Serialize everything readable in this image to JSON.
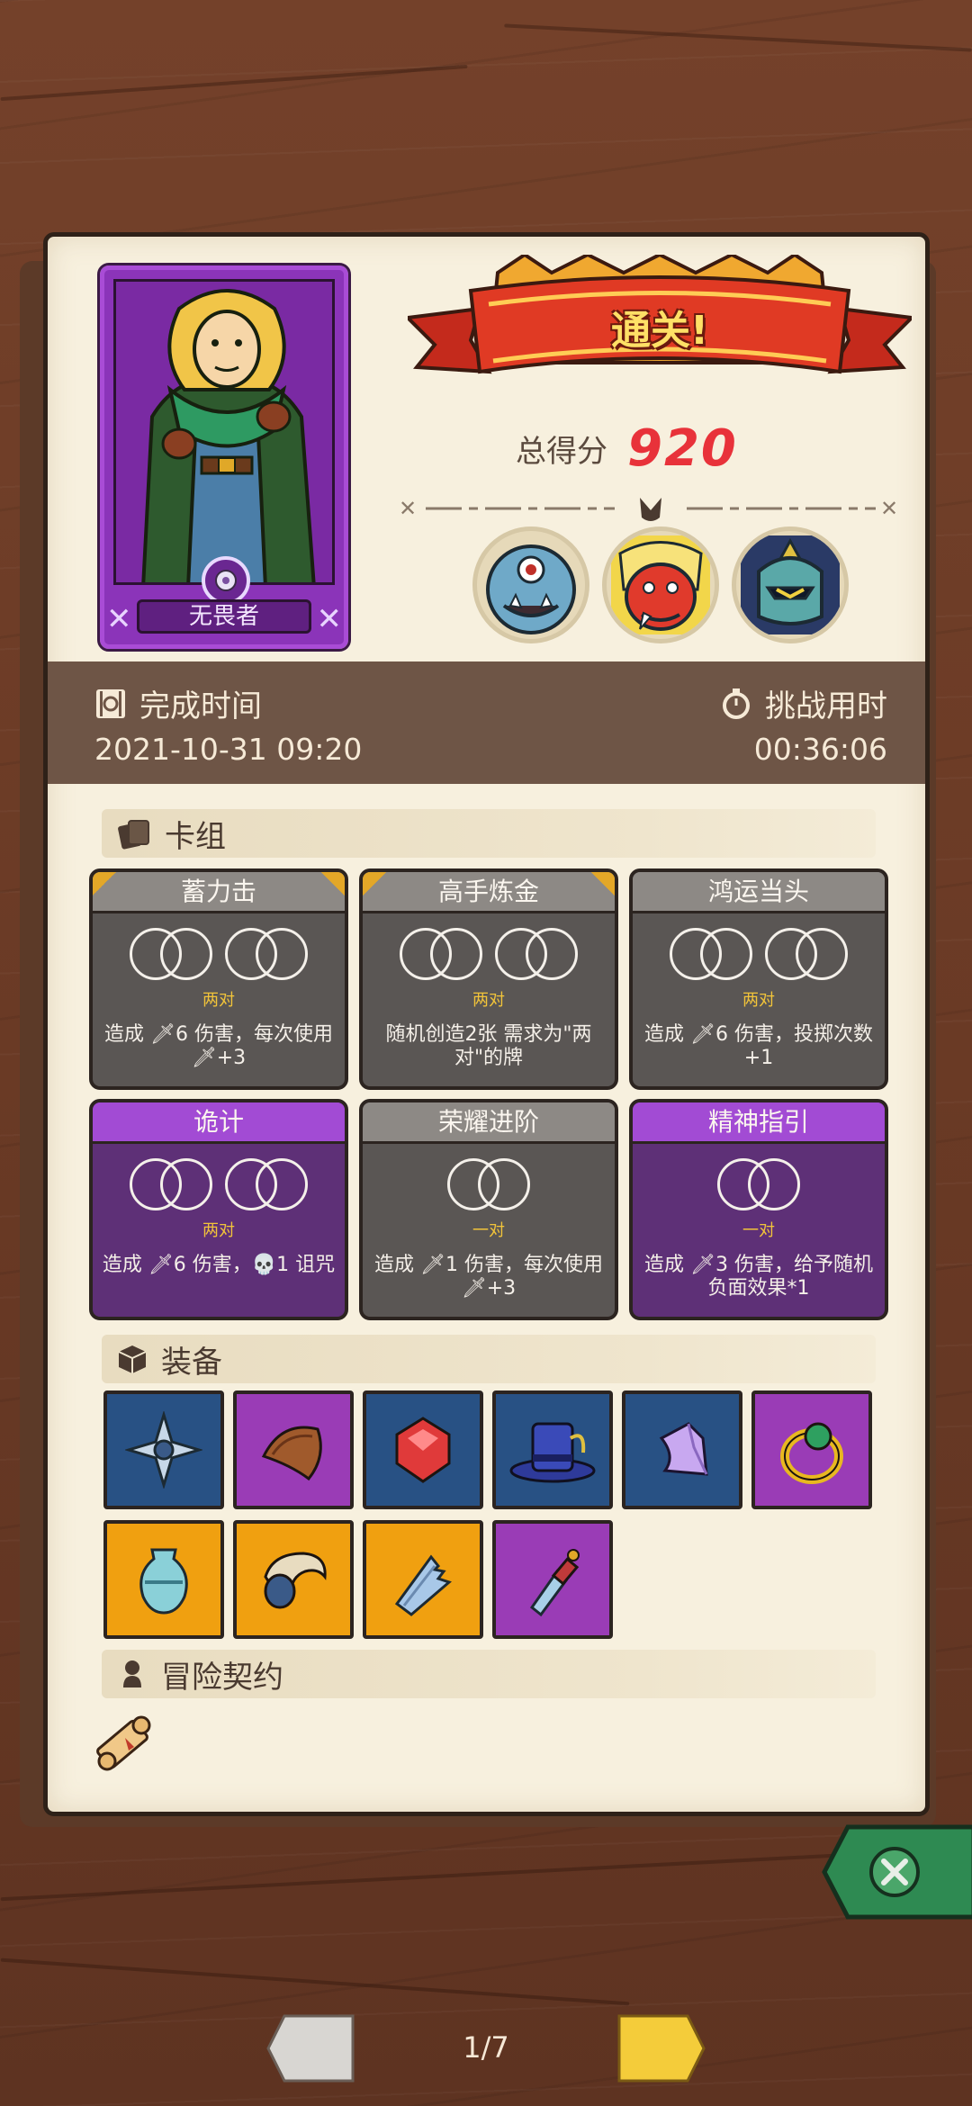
{
  "hero": {
    "name": "无畏者",
    "card_color": "#8b34b9"
  },
  "result": {
    "banner_text": "通关!",
    "score_label": "总得分",
    "score_value": "920"
  },
  "bosses": [
    {
      "icon": "blue-ogre-boss-icon"
    },
    {
      "icon": "red-demon-boss-icon"
    },
    {
      "icon": "armored-knight-boss-icon"
    }
  ],
  "time": {
    "finish_label": "完成时间",
    "finish_value": "2021-10-31 09:20",
    "challenge_label": "挑战用时",
    "challenge_value": "00:36:06"
  },
  "deck": {
    "title": "卡组",
    "cards": [
      {
        "name": "蓄力击",
        "tag": "两对",
        "desc": "造成 🗡6 伤害，每次使用 🗡+3",
        "style": "gray",
        "gold": true
      },
      {
        "name": "高手炼金",
        "tag": "两对",
        "desc": "随机创造2张 需求为\"两对\"的牌",
        "style": "gray",
        "gold": true
      },
      {
        "name": "鸿运当头",
        "tag": "两对",
        "desc": "造成 🗡6 伤害，投掷次数 +1",
        "style": "gray",
        "gold": false
      },
      {
        "name": "诡计",
        "tag": "两对",
        "desc": "造成 🗡6 伤害，💀1 诅咒",
        "style": "purple",
        "gold": false
      },
      {
        "name": "荣耀进阶",
        "tag": "一对",
        "desc": "造成 🗡1 伤害，每次使用 🗡+3",
        "style": "gray",
        "gold": false
      },
      {
        "name": "精神指引",
        "tag": "一对",
        "desc": "造成 🗡3 伤害，给予随机负面效果*1",
        "style": "purple",
        "gold": false
      }
    ]
  },
  "equipment": {
    "title": "装备",
    "items": [
      {
        "icon": "silver-star-emblem-icon",
        "color": "blue"
      },
      {
        "icon": "leather-shoulder-pad-icon",
        "color": "purple"
      },
      {
        "icon": "red-gem-icon",
        "color": "blue"
      },
      {
        "icon": "blue-top-hat-icon",
        "color": "blue"
      },
      {
        "icon": "purple-crescent-icon",
        "color": "blue"
      },
      {
        "icon": "emerald-ring-icon",
        "color": "purple"
      },
      {
        "icon": "teal-vase-icon",
        "color": "orange"
      },
      {
        "icon": "horn-cornucopia-icon",
        "color": "orange"
      },
      {
        "icon": "broken-blade-icon",
        "color": "orange"
      },
      {
        "icon": "crystal-dagger-icon",
        "color": "purple"
      }
    ]
  },
  "contract": {
    "title": "冒险契约",
    "items": [
      {
        "icon": "scroll-icon"
      }
    ]
  },
  "pagination": {
    "current": "1/7"
  }
}
